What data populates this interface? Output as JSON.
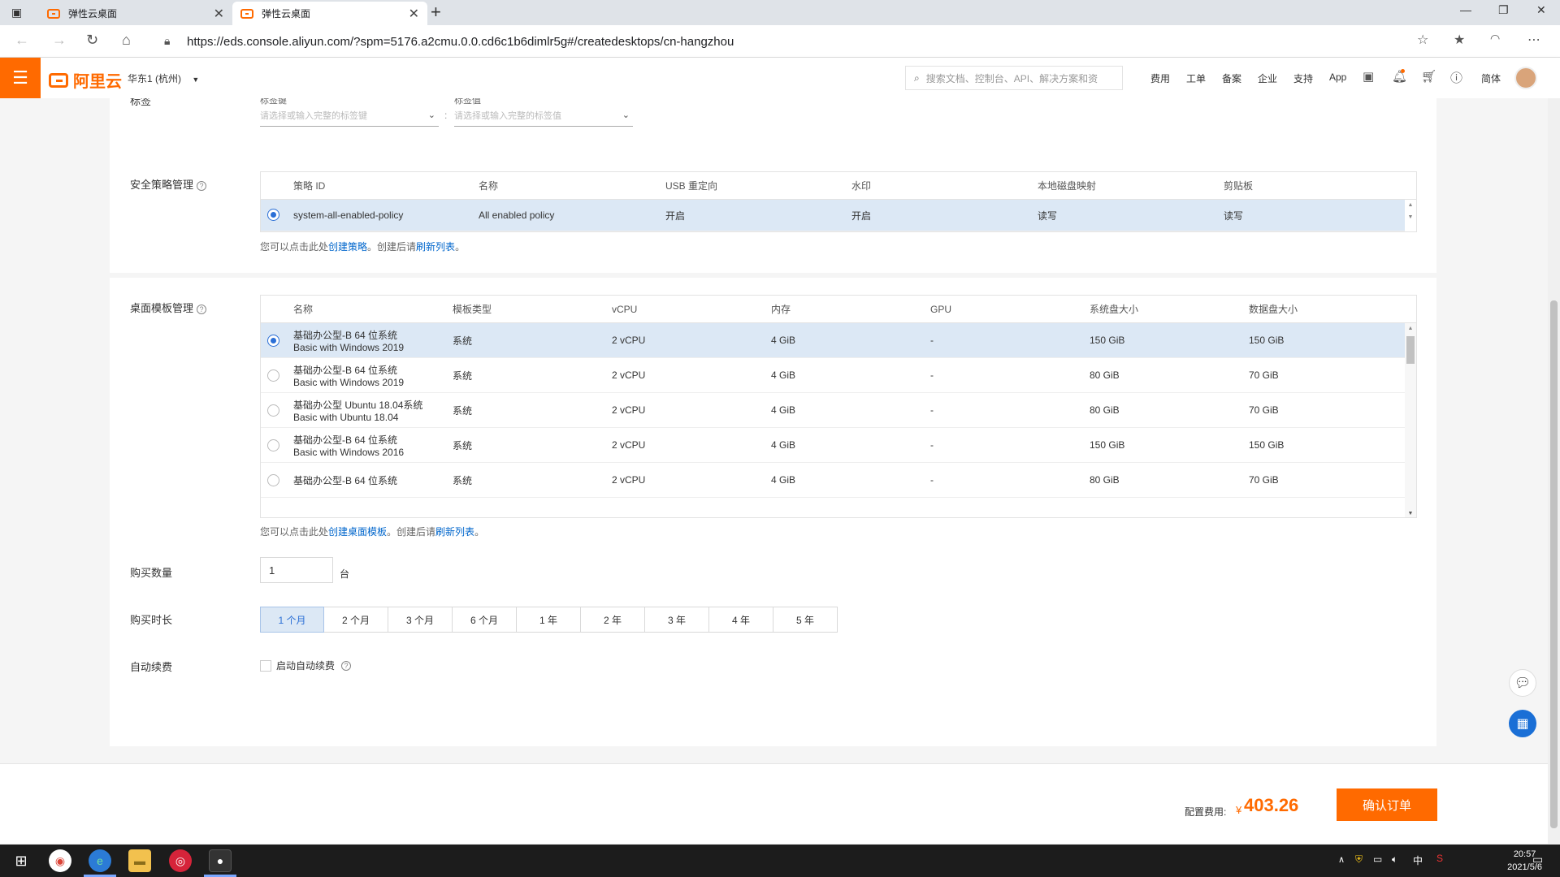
{
  "browser": {
    "tabs": [
      {
        "title": "弹性云桌面",
        "active": false
      },
      {
        "title": "弹性云桌面",
        "active": true
      }
    ],
    "url": "https://eds.console.aliyun.com/?spm=5176.a2cmu.0.0.cd6c1b6dimlr5g#/createdesktops/cn-hangzhou"
  },
  "header": {
    "logo_text": "阿里云",
    "region": "华东1 (杭州)",
    "search_placeholder": "搜索文档、控制台、API、解决方案和资",
    "nav": [
      "费用",
      "工单",
      "备案",
      "企业",
      "支持",
      "App"
    ],
    "lang": "简体"
  },
  "tags": {
    "label": "标签",
    "key_label": "标签键",
    "value_label": "标签值",
    "key_placeholder": "请选择或输入完整的标签键",
    "value_placeholder": "请选择或输入完整的标签值"
  },
  "security_policy": {
    "label": "安全策略管理",
    "columns": [
      "策略 ID",
      "名称",
      "USB 重定向",
      "水印",
      "本地磁盘映射",
      "剪贴板"
    ],
    "rows": [
      {
        "id": "system-all-enabled-policy",
        "name": "All enabled policy",
        "usb": "开启",
        "watermark": "开启",
        "disk": "读写",
        "clipboard": "读写",
        "selected": true
      }
    ],
    "hint_prefix": "您可以点击此处",
    "hint_link1": "创建策略",
    "hint_mid": "。创建后请",
    "hint_link2": "刷新列表",
    "hint_end": "。"
  },
  "templates": {
    "label": "桌面模板管理",
    "columns": [
      "名称",
      "模板类型",
      "vCPU",
      "内存",
      "GPU",
      "系统盘大小",
      "数据盘大小"
    ],
    "rows": [
      {
        "name1": "基础办公型-B 64 位系统",
        "name2": "Basic with Windows 2019",
        "type": "系统",
        "vcpu": "2 vCPU",
        "mem": "4 GiB",
        "gpu": "-",
        "sys": "150 GiB",
        "data": "150 GiB",
        "selected": true
      },
      {
        "name1": "基础办公型-B 64 位系统",
        "name2": "Basic with Windows 2019",
        "type": "系统",
        "vcpu": "2 vCPU",
        "mem": "4 GiB",
        "gpu": "-",
        "sys": "80 GiB",
        "data": "70 GiB",
        "selected": false
      },
      {
        "name1": "基础办公型 Ubuntu 18.04系统",
        "name2": "Basic with Ubuntu 18.04",
        "type": "系统",
        "vcpu": "2 vCPU",
        "mem": "4 GiB",
        "gpu": "-",
        "sys": "80 GiB",
        "data": "70 GiB",
        "selected": false
      },
      {
        "name1": "基础办公型-B 64 位系统",
        "name2": "Basic with Windows 2016",
        "type": "系统",
        "vcpu": "2 vCPU",
        "mem": "4 GiB",
        "gpu": "-",
        "sys": "150 GiB",
        "data": "150 GiB",
        "selected": false
      },
      {
        "name1": "基础办公型-B 64 位系统",
        "name2": "",
        "type": "系统",
        "vcpu": "2 vCPU",
        "mem": "4 GiB",
        "gpu": "-",
        "sys": "80 GiB",
        "data": "70 GiB",
        "selected": false
      }
    ],
    "hint_prefix": "您可以点击此处",
    "hint_link1": "创建桌面模板",
    "hint_mid": "。创建后请",
    "hint_link2": "刷新列表",
    "hint_end": "。"
  },
  "quantity": {
    "label": "购买数量",
    "value": "1",
    "unit": "台"
  },
  "duration": {
    "label": "购买时长",
    "options": [
      "1 个月",
      "2 个月",
      "3 个月",
      "6 个月",
      "1 年",
      "2 年",
      "3 年",
      "4 年",
      "5 年"
    ],
    "selected_index": 0
  },
  "auto_renew": {
    "label": "自动续费",
    "checkbox_label": "启动自动续费"
  },
  "footer": {
    "cost_label": "配置费用:",
    "currency": "¥",
    "cost": "403.26",
    "confirm": "确认订单"
  },
  "taskbar": {
    "time": "20:57",
    "date": "2021/5/6",
    "ime": "中"
  },
  "colors": {
    "accent": "#ff6a00",
    "link": "#0066cc",
    "selected_row": "#dce8f5"
  }
}
